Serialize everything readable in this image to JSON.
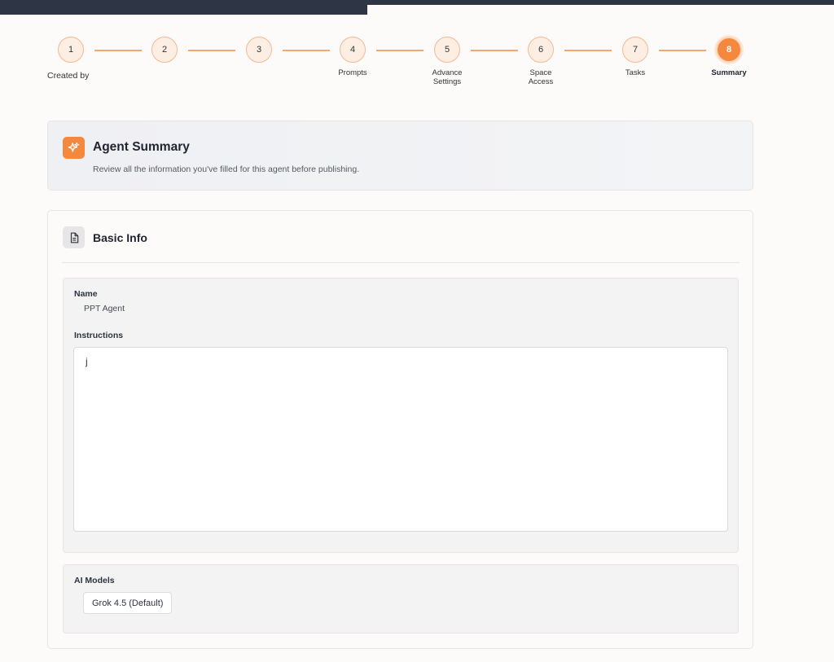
{
  "stepper": {
    "steps": [
      {
        "number": "1",
        "label": "Created by"
      },
      {
        "number": "2",
        "label": ""
      },
      {
        "number": "3",
        "label": ""
      },
      {
        "number": "4",
        "label": "Prompts"
      },
      {
        "number": "5",
        "label": "Advance\nSettings"
      },
      {
        "number": "6",
        "label": "Space\nAccess"
      },
      {
        "number": "7",
        "label": "Tasks"
      },
      {
        "number": "8",
        "label": "Summary"
      }
    ],
    "active_step": 8
  },
  "summary": {
    "title": "Agent Summary",
    "subtitle": "Review all the information you've filled for this agent before publishing."
  },
  "basic_info": {
    "title": "Basic Info",
    "name_label": "Name",
    "name_value": "PPT Agent",
    "instructions_label": "Instructions",
    "instructions_value": "j",
    "ai_models_label": "AI Models",
    "ai_models": [
      "Grok 4.5 (Default)"
    ]
  },
  "colors": {
    "accent": "#f5883f",
    "topbar": "#2e3646"
  }
}
